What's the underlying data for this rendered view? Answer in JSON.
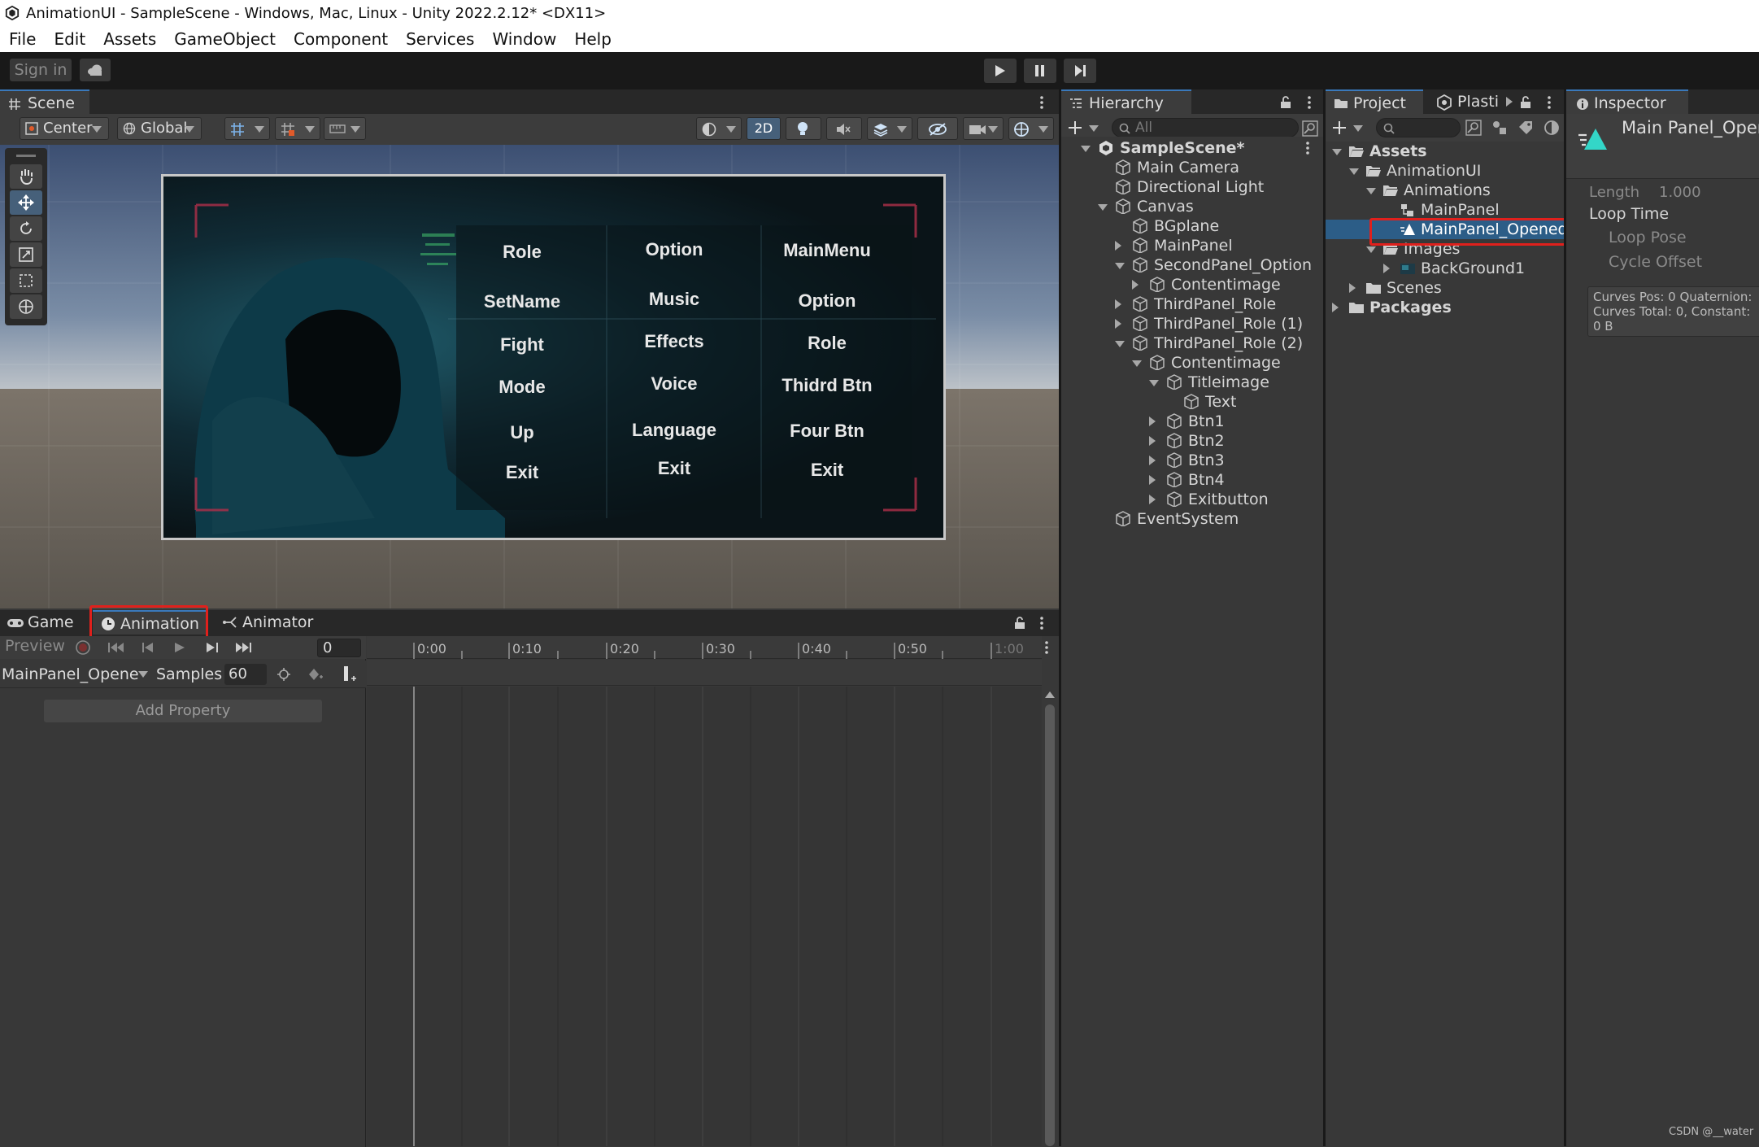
{
  "window": {
    "title": "AnimationUI - SampleScene - Windows, Mac, Linux - Unity 2022.2.12* <DX11>"
  },
  "menu": [
    "File",
    "Edit",
    "Assets",
    "GameObject",
    "Component",
    "Services",
    "Window",
    "Help"
  ],
  "toolbar": {
    "sign_in": "Sign in"
  },
  "scene": {
    "tab": "Scene",
    "pivot": "Center",
    "space": "Global",
    "mode_2d": "2D",
    "game_columns": [
      [
        "Role",
        "SetName",
        "Fight",
        "Mode",
        "Up",
        "Exit"
      ],
      [
        "Option",
        "Music",
        "Effects",
        "Voice",
        "Language",
        "Exit"
      ],
      [
        "MainMenu",
        "Option",
        "Role",
        "Thidrd Btn",
        "Four Btn",
        "Exit"
      ]
    ]
  },
  "bottom_tabs": {
    "game": "Game",
    "animation": "Animation",
    "animator": "Animator"
  },
  "animation": {
    "preview": "Preview",
    "frame": "0",
    "clip": "MainPanel_Opene",
    "samples_label": "Samples",
    "samples": "60",
    "add_property": "Add Property",
    "ruler": [
      "0:00",
      "0:10",
      "0:20",
      "0:30",
      "0:40",
      "0:50",
      "1:00"
    ]
  },
  "hierarchy": {
    "tab": "Hierarchy",
    "search_placeholder": "All",
    "items": [
      {
        "label": "SampleScene*",
        "depth": 0,
        "bold": true,
        "arrow": "down"
      },
      {
        "label": "Main Camera",
        "depth": 1,
        "arrow": ""
      },
      {
        "label": "Directional Light",
        "depth": 1,
        "arrow": ""
      },
      {
        "label": "Canvas",
        "depth": 1,
        "arrow": "down"
      },
      {
        "label": "BGplane",
        "depth": 2,
        "arrow": ""
      },
      {
        "label": "MainPanel",
        "depth": 2,
        "arrow": "right"
      },
      {
        "label": "SecondPanel_Option",
        "depth": 2,
        "arrow": "down"
      },
      {
        "label": "Contentimage",
        "depth": 3,
        "arrow": "right"
      },
      {
        "label": "ThirdPanel_Role",
        "depth": 2,
        "arrow": "right"
      },
      {
        "label": "ThirdPanel_Role (1)",
        "depth": 2,
        "arrow": "right"
      },
      {
        "label": "ThirdPanel_Role (2)",
        "depth": 2,
        "arrow": "down"
      },
      {
        "label": "Contentimage",
        "depth": 3,
        "arrow": "down"
      },
      {
        "label": "Titleimage",
        "depth": 4,
        "arrow": "down"
      },
      {
        "label": "Text",
        "depth": 5,
        "arrow": ""
      },
      {
        "label": "Btn1",
        "depth": 4,
        "arrow": "right"
      },
      {
        "label": "Btn2",
        "depth": 4,
        "arrow": "right"
      },
      {
        "label": "Btn3",
        "depth": 4,
        "arrow": "right"
      },
      {
        "label": "Btn4",
        "depth": 4,
        "arrow": "right"
      },
      {
        "label": "Exitbutton",
        "depth": 4,
        "arrow": "right"
      },
      {
        "label": "EventSystem",
        "depth": 1,
        "arrow": ""
      }
    ]
  },
  "project": {
    "tab": "Project",
    "tab2": "Plasti",
    "items": [
      {
        "label": "Assets",
        "depth": 0,
        "bold": true,
        "arrow": "down",
        "icon": "folder"
      },
      {
        "label": "AnimationUI",
        "depth": 1,
        "arrow": "down",
        "icon": "folder"
      },
      {
        "label": "Animations",
        "depth": 2,
        "arrow": "down",
        "icon": "folder"
      },
      {
        "label": "MainPanel",
        "depth": 3,
        "arrow": "",
        "icon": "controller"
      },
      {
        "label": "MainPanel_Opened",
        "depth": 3,
        "arrow": "",
        "icon": "clip",
        "selected": true
      },
      {
        "label": "Images",
        "depth": 2,
        "arrow": "down",
        "icon": "folder"
      },
      {
        "label": "BackGround1",
        "depth": 3,
        "arrow": "right",
        "icon": "image"
      },
      {
        "label": "Scenes",
        "depth": 1,
        "arrow": "right",
        "icon": "folder"
      },
      {
        "label": "Packages",
        "depth": 0,
        "bold": true,
        "arrow": "right",
        "icon": "folder"
      }
    ]
  },
  "inspector": {
    "tab": "Inspector",
    "title": "Main Panel_Opene",
    "length_label": "Length",
    "length_value": "1.000",
    "loop_time": "Loop Time",
    "loop_pose": "Loop Pose",
    "cycle_offset": "Cycle Offset",
    "info": [
      "Curves Pos: 0 Quaternion:",
      "Curves Total: 0, Constant:",
      "0 B"
    ]
  },
  "watermark": "CSDN @__water",
  "colors": {
    "accent": "#3a79bb",
    "selection": "#2c5d87",
    "highlight_box": "#e0201c"
  }
}
